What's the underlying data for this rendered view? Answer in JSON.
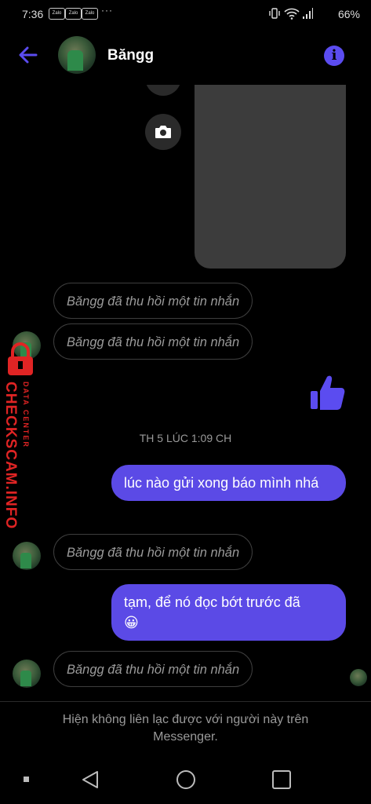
{
  "status_bar": {
    "time": "7:36",
    "notif_apps": [
      "Zalo",
      "Zalo",
      "Zalo"
    ],
    "overflow": "···",
    "battery": "66%"
  },
  "header": {
    "contact_name": "Băngg",
    "back_icon": "arrow-left-icon",
    "info_icon": "info-icon",
    "accent_color": "#5b4cf0"
  },
  "messages": {
    "recalled_1": "Băngg đã thu hồi một tin nhắn",
    "recalled_2": "Băngg đã thu hồi một tin nhắn",
    "timestamp": "TH 5 LÚC 1:09 CH",
    "sent_1": "lúc nào gửi xong báo mình nhá",
    "recalled_3": "Băngg đã thu hồi một tin nhắn",
    "sent_2": "tạm, để nó đọc bớt trước đã",
    "sent_2_emoji": "😀",
    "recalled_4": "Băngg đã thu hồi một tin nhắn"
  },
  "footer": {
    "notice": "Hiện không liên lạc được với người này trên Messenger."
  },
  "watermark": {
    "brand": "CHECKSCAM.INFO",
    "tagline": "DATA CENTER"
  }
}
